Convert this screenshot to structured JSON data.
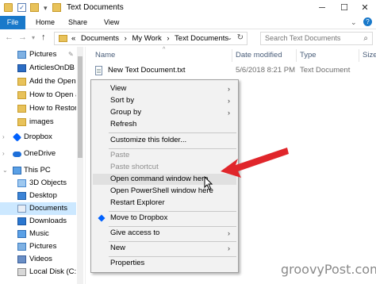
{
  "window": {
    "title": "Text Documents",
    "controls": {
      "minimize": "─",
      "maximize": "☐",
      "close": "✕"
    }
  },
  "ribbon": {
    "tabs": [
      "File",
      "Home",
      "Share",
      "View"
    ],
    "collapse_icon": "chevron-down-icon",
    "help_label": "?"
  },
  "address": {
    "prefix": "«",
    "crumbs": [
      "Documents",
      "›",
      "My Work",
      "›",
      "Text Documents"
    ],
    "search_placeholder": "Search Text Documents"
  },
  "nav": {
    "items": [
      {
        "label": "Pictures",
        "icon": "pictures-icon",
        "pinned": true
      },
      {
        "label": "ArticlesOnDB",
        "icon": "word-doc-icon",
        "pinned": true
      },
      {
        "label": "Add the Open C",
        "icon": "folder-icon",
        "pinned": false
      },
      {
        "label": "How to Open a C",
        "icon": "folder-icon",
        "pinned": false
      },
      {
        "label": "How to Restore t",
        "icon": "folder-icon",
        "pinned": false
      },
      {
        "label": "images",
        "icon": "folder-icon",
        "pinned": false
      },
      {
        "label": "Dropbox",
        "icon": "dropbox-icon",
        "pinned": false
      },
      {
        "label": "OneDrive",
        "icon": "onedrive-icon",
        "pinned": false
      },
      {
        "label": "This PC",
        "icon": "this-pc-icon",
        "pinned": false
      },
      {
        "label": "3D Objects",
        "icon": "3d-objects-icon",
        "pinned": false
      },
      {
        "label": "Desktop",
        "icon": "desktop-icon",
        "pinned": false
      },
      {
        "label": "Documents",
        "icon": "documents-icon",
        "pinned": false
      },
      {
        "label": "Downloads",
        "icon": "downloads-icon",
        "pinned": false
      },
      {
        "label": "Music",
        "icon": "music-icon",
        "pinned": false
      },
      {
        "label": "Pictures",
        "icon": "pictures-icon",
        "pinned": false
      },
      {
        "label": "Videos",
        "icon": "videos-icon",
        "pinned": false
      },
      {
        "label": "Local Disk (C:)",
        "icon": "disk-icon",
        "pinned": false
      }
    ]
  },
  "columns": [
    "Name",
    "Date modified",
    "Type",
    "Size"
  ],
  "files": [
    {
      "name": "New Text Document.txt",
      "date": "5/6/2018 8:21 PM",
      "type": "Text Document"
    }
  ],
  "context_menu": {
    "items": [
      {
        "label": "View",
        "submenu": true
      },
      {
        "label": "Sort by",
        "submenu": true
      },
      {
        "label": "Group by",
        "submenu": true
      },
      {
        "label": "Refresh"
      },
      {
        "label": "Customize this folder..."
      },
      {
        "label": "Paste",
        "disabled": true
      },
      {
        "label": "Paste shortcut",
        "disabled": true
      },
      {
        "label": "Open command window here"
      },
      {
        "label": "Open PowerShell window here"
      },
      {
        "label": "Restart Explorer"
      },
      {
        "label": "Move to Dropbox"
      },
      {
        "label": "Give access to",
        "submenu": true
      },
      {
        "label": "New",
        "submenu": true
      },
      {
        "label": "Properties"
      }
    ],
    "submenu_arrow": "›"
  },
  "watermark": "groovyPost.com",
  "colors": {
    "accent": "#1979ca",
    "arrow": "#e0262b",
    "selected": "#cce8ff"
  }
}
